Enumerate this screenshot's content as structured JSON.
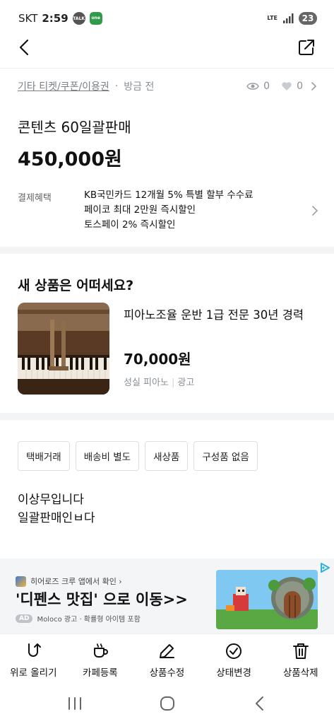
{
  "status_bar": {
    "carrier": "SKT",
    "time": "2:59",
    "talk_icon_text": "TALK",
    "one_icon_text": "one",
    "network": "LTE",
    "battery": "23"
  },
  "meta": {
    "category": "기타 티켓/쿠폰/이용권",
    "time_ago": "방금 전",
    "views": "0",
    "likes": "0"
  },
  "product": {
    "title": "콘텐츠 60일괄판매",
    "price": "450,000원",
    "benefit_label": "결제혜택",
    "benefits": [
      "KB국민카드 12개월 5% 특별 할부 수수료",
      "페이코 최대 2만원 즉시할인",
      "토스페이 2% 즉시할인"
    ]
  },
  "recommend": {
    "title": "새 상품은 어떠세요?",
    "item": {
      "title": "피아노조율 운반 1급 전문 30년 경력",
      "price": "70,000원",
      "seller": "성실 피아노",
      "ad_label": "광고"
    }
  },
  "tags": [
    "택배거래",
    "배송비 별도",
    "새상품",
    "구성품 없음"
  ],
  "description": [
    "이상무입니다",
    "일괄판매인ㅂ다"
  ],
  "banner": {
    "source": "히어로즈 크루 앱에서 확인 ›",
    "headline": "'디펜스 맛집' 으로 이동>>",
    "ad_badge": "AD",
    "footer": "Moloco 광고 · 확률형 아이템 포함"
  },
  "actions": [
    {
      "label": "위로 올리기",
      "icon": "bump-up-icon"
    },
    {
      "label": "카페등록",
      "icon": "cafe-cup-icon"
    },
    {
      "label": "상품수정",
      "icon": "pencil-icon"
    },
    {
      "label": "상태변경",
      "icon": "check-circle-icon"
    },
    {
      "label": "상품삭제",
      "icon": "trash-icon"
    }
  ],
  "colors": {
    "text": "#111111",
    "muted": "#8a8f95",
    "section_bg": "#f3f4f6",
    "banner_bg": "#f4f5f7",
    "adchoices": "#2bb3d8"
  }
}
